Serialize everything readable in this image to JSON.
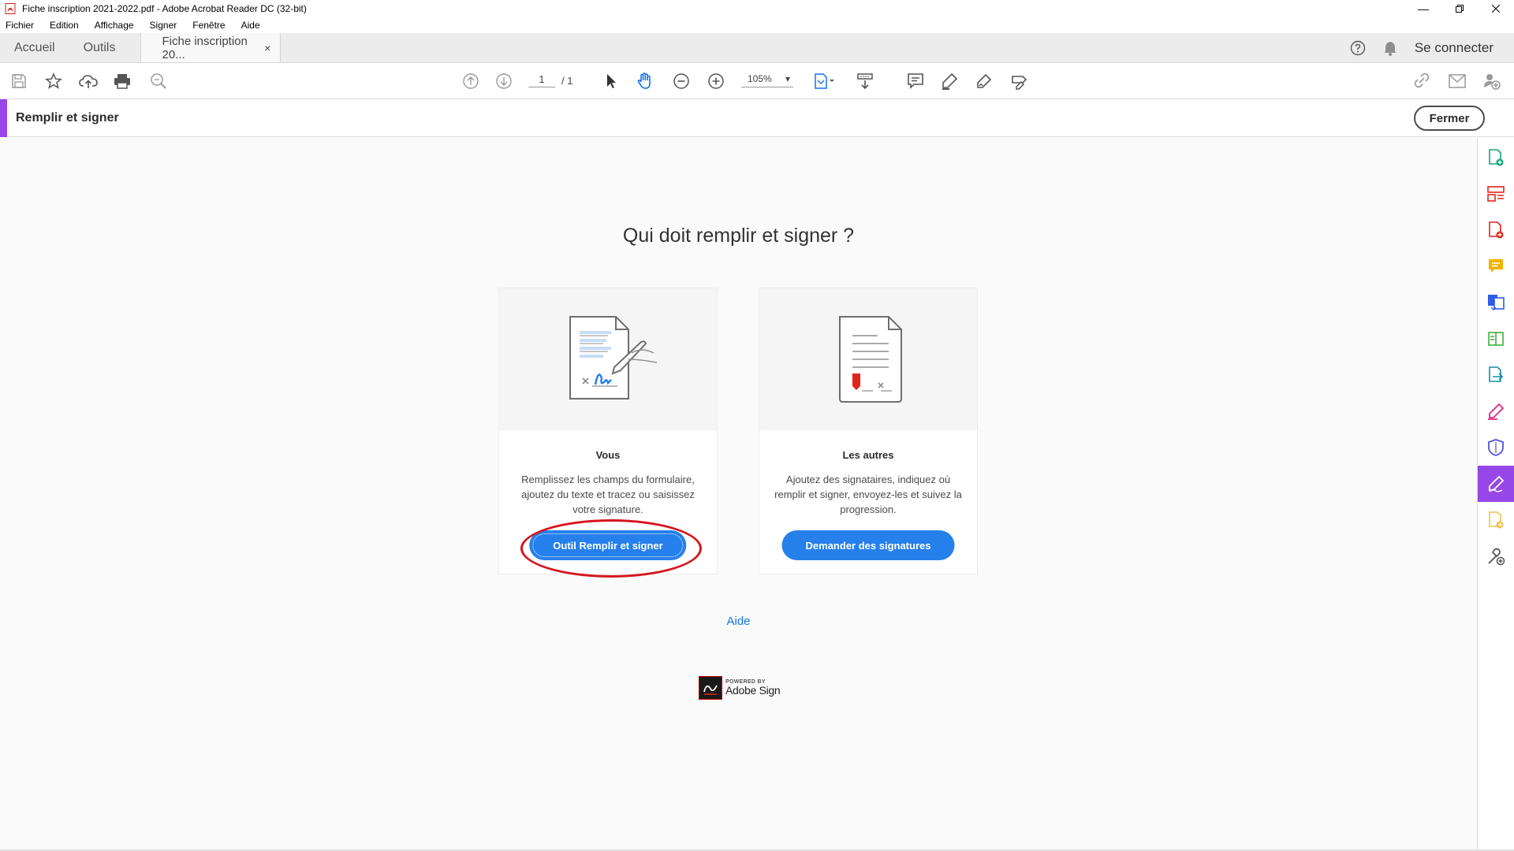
{
  "window": {
    "title": "Fiche inscription 2021-2022.pdf - Adobe Acrobat Reader DC (32-bit)"
  },
  "menu": [
    "Fichier",
    "Edition",
    "Affichage",
    "Signer",
    "Fenêtre",
    "Aide"
  ],
  "tabs": {
    "home": "Accueil",
    "tools": "Outils",
    "document": "Fiche inscription 20...",
    "close_glyph": "×",
    "connect": "Se connecter"
  },
  "toolbar": {
    "page_current": "1",
    "page_total": "/ 1",
    "zoom": "105%"
  },
  "fill_sign": {
    "title": "Remplir et signer",
    "close_label": "Fermer"
  },
  "main": {
    "heading": "Qui doit remplir et signer ?",
    "cards": [
      {
        "title": "Vous",
        "description": "Remplissez les champs du formulaire, ajoutez du texte et tracez ou saisissez votre signature.",
        "button": "Outil Remplir et signer"
      },
      {
        "title": "Les autres",
        "description": "Ajoutez des signataires, indiquez où remplir et signer, envoyez-les et suivez la progression.",
        "button": "Demander des signatures"
      }
    ],
    "help_link": "Aide",
    "powered_by": "POWERED BY",
    "brand": "Adobe Sign"
  },
  "colors": {
    "accent_purple": "#9747e8",
    "primary_blue": "#2680eb",
    "highlight_red": "#d6141c",
    "link_blue": "#1473e6"
  },
  "icons": {
    "toolbar": [
      "save-icon",
      "bookmark-star-icon",
      "cloud-upload-icon",
      "print-icon",
      "search-zoom-icon",
      "page-up-icon",
      "page-down-icon",
      "select-arrow-icon",
      "hand-icon",
      "zoom-out-icon",
      "zoom-in-icon",
      "fit-page-icon",
      "scroll-mode-icon",
      "comment-icon",
      "highlight-pen-icon",
      "sign-icon",
      "fill-sign-icon",
      "link-icon",
      "mail-icon",
      "add-user-icon"
    ],
    "right_panel": [
      "export-pdf-icon",
      "organize-pages-icon",
      "create-pdf-icon",
      "comment-icon",
      "combine-files-icon",
      "edit-pdf-icon",
      "export-icon",
      "fill-sign-pen-icon",
      "protect-shield-icon",
      "fill-sign-active-icon",
      "send-track-icon",
      "more-tools-icon"
    ]
  }
}
